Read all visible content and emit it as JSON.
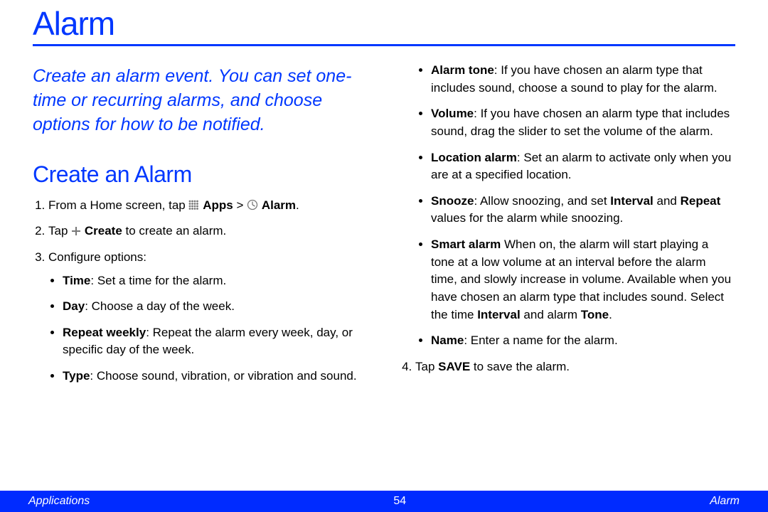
{
  "title": "Alarm",
  "intro": "Create an alarm event. You can set one-time or recurring alarms, and choose options for how to be notified.",
  "section_heading": "Create an Alarm",
  "step1": {
    "prefix": "From a Home screen, tap ",
    "apps_label": "Apps",
    "gt": " > ",
    "alarm_label": "Alarm",
    "suffix": "."
  },
  "step2": {
    "prefix": "Tap ",
    "create_label": "Create",
    "suffix": " to create an alarm."
  },
  "step3_label": "Configure options:",
  "step4": {
    "prefix": "Tap ",
    "save_label": "SAVE",
    "suffix": " to save the alarm."
  },
  "options_left": {
    "time_b": "Time",
    "time_r": ": Set a time for the alarm.",
    "day_b": "Day",
    "day_r": ": Choose a day of the week.",
    "repeat_b": "Repeat weekly",
    "repeat_r": ": Repeat the alarm every week, day, or specific day of the week.",
    "type_b": "Type",
    "type_r": ": Choose sound, vibration, or vibration and sound."
  },
  "options_right": {
    "tone_b": "Alarm tone",
    "tone_r": ": If you have chosen an alarm type that includes sound, choose a sound to play for the alarm.",
    "vol_b": "Volume",
    "vol_r": ": If you have chosen an alarm type that includes sound, drag the slider to set the volume of the alarm.",
    "loc_b": "Location alarm",
    "loc_r": ": Set an alarm to activate only when you are at a specified location.",
    "snooze_b": "Snooze",
    "snooze_p1": ": Allow snoozing, and set ",
    "snooze_int": "Interval",
    "snooze_p2": " and ",
    "snooze_rep": "Repeat",
    "snooze_p3": " values for the alarm while snoozing.",
    "smart_b": "Smart alarm",
    "smart_p1": " When on, the alarm will start playing a tone at a low volume at an interval before the alarm time, and slowly increase in volume. Available when you have chosen an alarm type that includes sound. Select the time ",
    "smart_int": "Interval",
    "smart_p2": " and alarm ",
    "smart_tone": "Tone",
    "smart_p3": ".",
    "name_b": "Name",
    "name_r": ": Enter a name for the alarm."
  },
  "footer": {
    "left": "Applications",
    "page": "54",
    "right": "Alarm"
  }
}
